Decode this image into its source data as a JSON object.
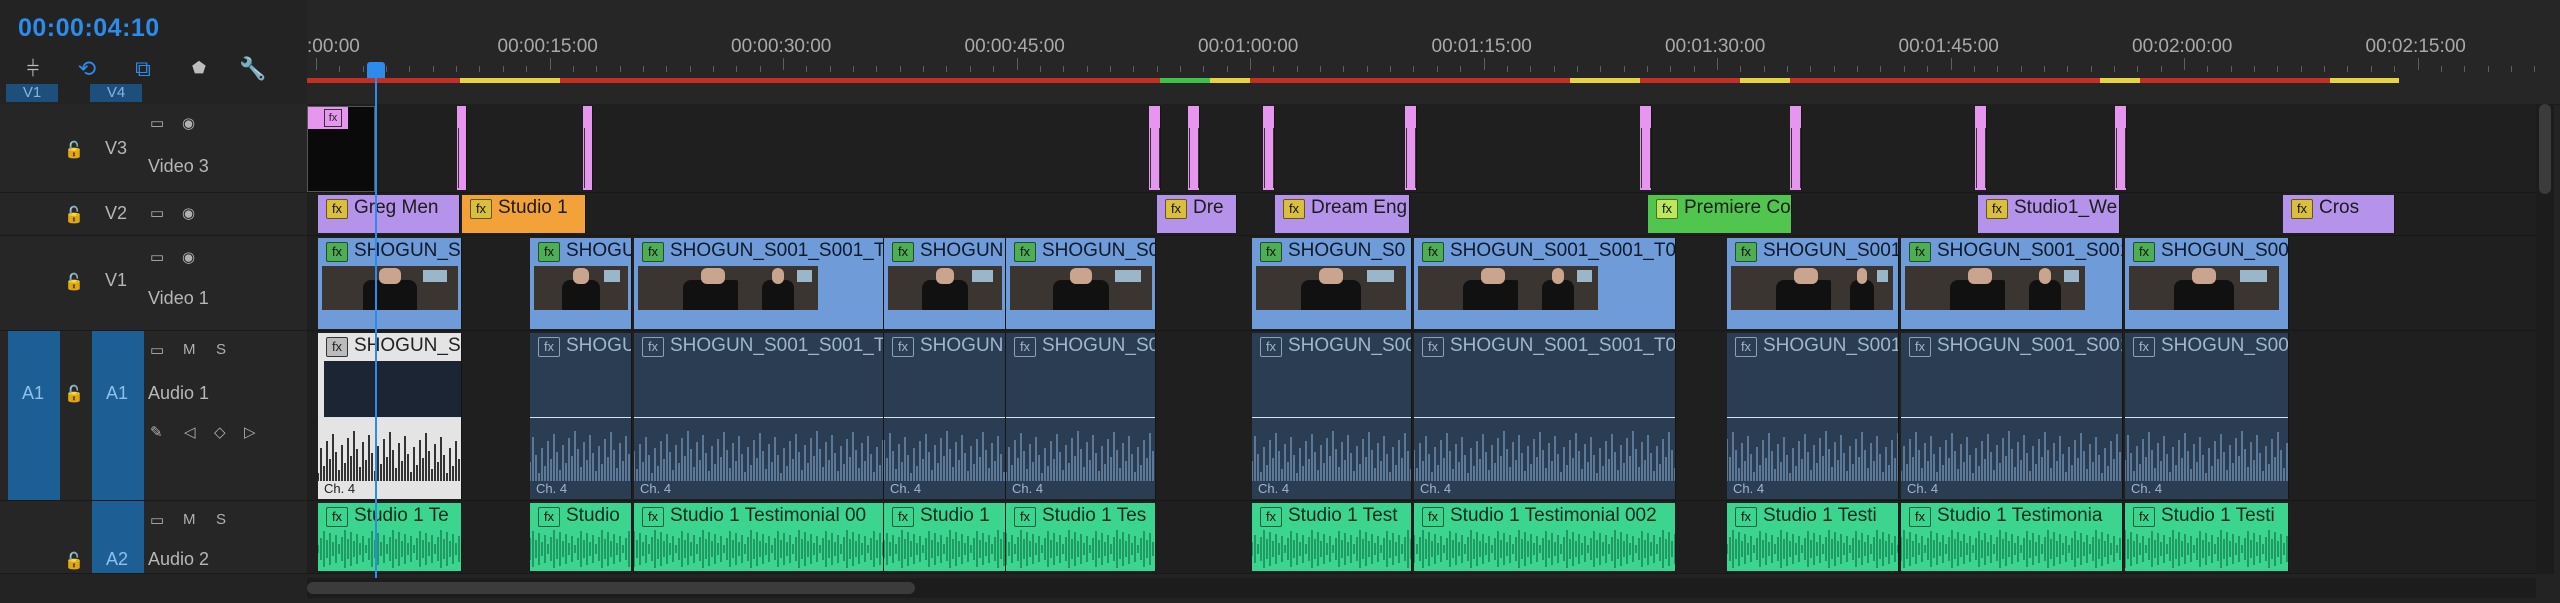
{
  "timecode": "00:00:04:10",
  "tools": [
    {
      "name": "snap-icon",
      "glyph": "⫩"
    },
    {
      "name": "linked-selection-icon",
      "glyph": "⟲"
    },
    {
      "name": "add-marker-icon",
      "glyph": "⧉"
    },
    {
      "name": "marker-icon",
      "glyph": "⬟"
    },
    {
      "name": "wrench-icon",
      "glyph": "🔧"
    }
  ],
  "source_patch": {
    "video": "V1",
    "audio": "V4"
  },
  "ruler": {
    "labels": [
      ":00:00",
      "00:00:15:00",
      "00:00:30:00",
      "00:00:45:00",
      "00:01:00:00",
      "00:01:15:00",
      "00:01:30:00",
      "00:01:45:00",
      "00:02:00:00",
      "00:02:15:00"
    ]
  },
  "tracks": {
    "v3": {
      "id": "V3",
      "name": "Video 3"
    },
    "v2": {
      "id": "V2",
      "name": ""
    },
    "v1": {
      "id": "V1",
      "name": "Video 1"
    },
    "a1": {
      "source": "A1",
      "id": "A1",
      "name": "Audio 1"
    },
    "a2": {
      "id": "A2",
      "name": "Audio 2"
    }
  },
  "header_glyphs": {
    "film": "▭",
    "eye": "◉",
    "lock": "🔓",
    "mute": "M",
    "solo": "S",
    "keyframe": "◇",
    "prev": "◁",
    "next": "▷",
    "pen": "✎"
  },
  "fx_label": "fx",
  "v2_clips": [
    {
      "label": "Greg Men"
    },
    {
      "label": "Studio 1"
    },
    {
      "label": "Dre"
    },
    {
      "label": "Dream Eng"
    },
    {
      "label": "Premiere Co"
    },
    {
      "label": "Studio1_We"
    },
    {
      "label": "Cros"
    }
  ],
  "v1_clips": [
    {
      "label": "SHOGUN_SO"
    },
    {
      "label": "SHOGU"
    },
    {
      "label": "SHOGUN_S001_S001_T"
    },
    {
      "label": "SHOGUN"
    },
    {
      "label": "SHOGUN_S0"
    },
    {
      "label": "SHOGUN_S0"
    },
    {
      "label": "SHOGUN_S001_S001_T09"
    },
    {
      "label": "SHOGUN_S001"
    },
    {
      "label": "SHOGUN_S001_S001"
    },
    {
      "label": "SHOGUN_S00"
    }
  ],
  "a1_clips": [
    {
      "label": "SHOGUN_SO",
      "ch": "Ch. 4"
    },
    {
      "label": "SHOGU",
      "ch": "Ch. 4"
    },
    {
      "label": "SHOGUN_S001_S001_T",
      "ch": "Ch. 4"
    },
    {
      "label": "SHOGUN",
      "ch": "Ch. 4"
    },
    {
      "label": "SHOGUN_S0",
      "ch": "Ch. 4"
    },
    {
      "label": "SHOGUN_S00",
      "ch": "Ch. 4"
    },
    {
      "label": "SHOGUN_S001_S001_T09",
      "ch": "Ch. 4"
    },
    {
      "label": "SHOGUN_S001",
      "ch": "Ch. 4"
    },
    {
      "label": "SHOGUN_S001_S001",
      "ch": "Ch. 4"
    },
    {
      "label": "SHOGUN_S00",
      "ch": "Ch. 4"
    }
  ],
  "a2_clips": [
    {
      "label": "Studio 1 Te"
    },
    {
      "label": "Studio"
    },
    {
      "label": "Studio 1 Testimonial 00"
    },
    {
      "label": "Studio 1"
    },
    {
      "label": "Studio 1 Tes"
    },
    {
      "label": "Studio 1 Test"
    },
    {
      "label": "Studio 1 Testimonial 002"
    },
    {
      "label": "Studio 1 Testi"
    },
    {
      "label": "Studio 1 Testimonia"
    },
    {
      "label": "Studio 1 Testi"
    }
  ],
  "colors": {
    "accent": "#2d8ceb",
    "v2_clip": "#b693ea",
    "title_orange": "#f3a23a",
    "title_green": "#51c64f",
    "video_clip": "#6f9bd8",
    "audio1_clip": "#2a3d53",
    "audio2_clip": "#3bd58f",
    "render_red": "#c42f23",
    "render_yellow": "#e6d43c",
    "render_green": "#3ec24a"
  }
}
